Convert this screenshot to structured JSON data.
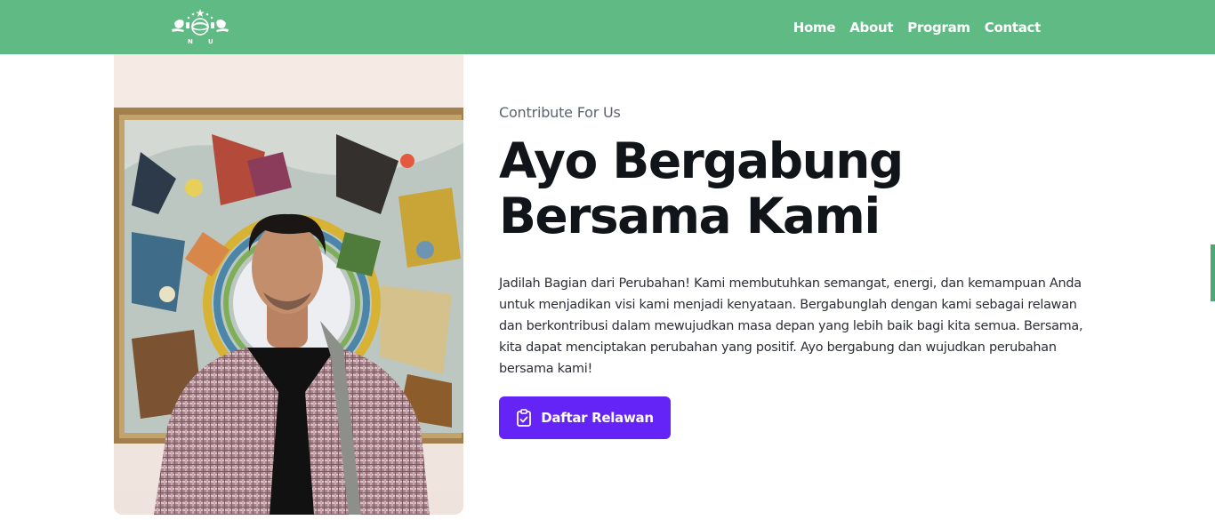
{
  "nav": {
    "links": [
      "Home",
      "About",
      "Program",
      "Contact"
    ]
  },
  "hero": {
    "eyebrow": "Contribute For Us",
    "headline": "Ayo Bergabung Bersama Kami",
    "description": "Jadilah Bagian dari Perubahan! Kami membutuhkan semangat, energi, dan kemampuan Anda untuk menjadikan visi kami menjadi kenyataan. Bergabunglah dengan kami sebagai relawan dan berkontribusi dalam mewujudkan masa depan yang lebih baik bagi kita semua. Bersama, kita dapat menciptakan perubahan yang positif. Ayo bergabung dan wujudkan perubahan bersama kami!",
    "cta_label": "Daftar Relawan",
    "cta_icon": "clipboard-check-icon"
  },
  "colors": {
    "navbar": "#5fba84",
    "cta": "#6424f6",
    "headline": "#111418"
  }
}
